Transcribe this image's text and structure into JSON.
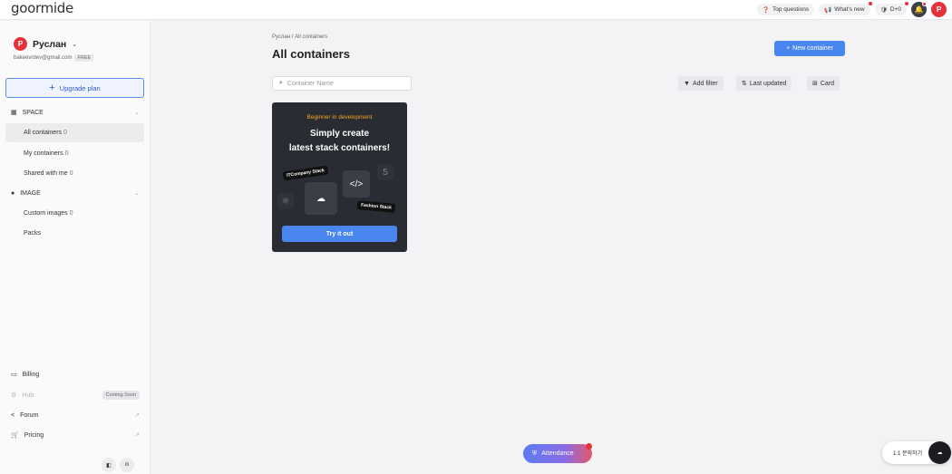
{
  "app": {
    "logo": "goormide"
  },
  "topbar": {
    "top_questions": "Top questions",
    "whats_new": "What's new",
    "d_day": "D+0",
    "avatar_initial": "P"
  },
  "sidebar": {
    "user": {
      "initial": "P",
      "name": "Руслан",
      "email": "bakeevrdev@gmail.com",
      "plan_badge": "FREE"
    },
    "upgrade_label": "Upgrade plan",
    "space_section": "SPACE",
    "space_items": [
      {
        "label": "All containers",
        "count": "0"
      },
      {
        "label": "My containers",
        "count": "0"
      },
      {
        "label": "Shared with me",
        "count": "0"
      }
    ],
    "image_section": "IMAGE",
    "image_items": [
      {
        "label": "Custom images",
        "count": "0"
      },
      {
        "label": "Packs",
        "count": ""
      }
    ],
    "bottom": {
      "billing": "Billing",
      "hub": "Hub",
      "hub_badge": "Coming Soon",
      "forum": "Forum",
      "pricing": "Pricing"
    }
  },
  "main": {
    "breadcrumb": {
      "user": "Руслан",
      "sep": "/",
      "current": "All containers"
    },
    "title": "All containers",
    "new_container_label": "New container",
    "search_placeholder": "Container Name",
    "add_filter": "Add filter",
    "sort": "Last updated",
    "view": "Card"
  },
  "promo": {
    "tagline": "Beginner in development",
    "headline_1": "Simply create",
    "headline_2": "latest stack containers!",
    "label_1": "ITCompany Stack",
    "label_2": "Fashion Stack",
    "cta": "Try it out"
  },
  "floating": {
    "attendance": "Attendance",
    "help": "1:1 문의하기"
  },
  "colors": {
    "primary": "#4a86f0",
    "danger": "#e4323b",
    "promo_bg": "#2a2c33",
    "promo_accent": "#f5a623"
  }
}
